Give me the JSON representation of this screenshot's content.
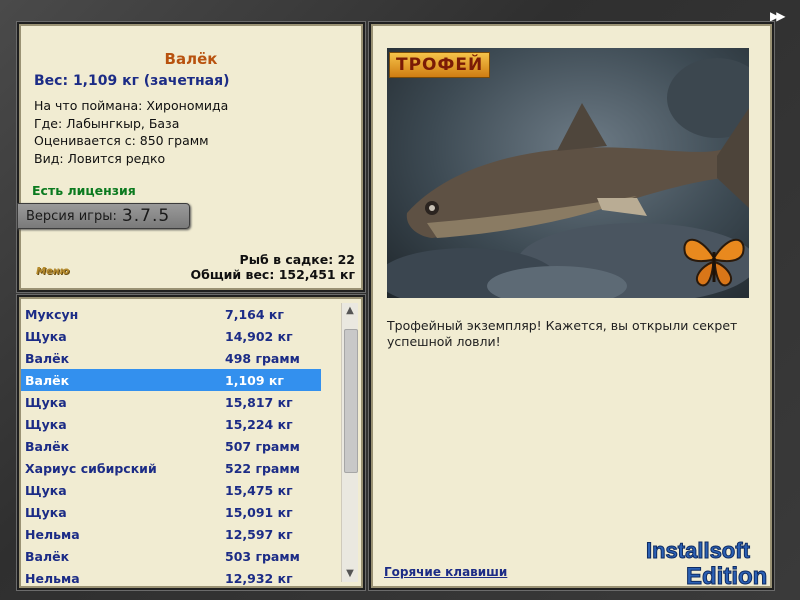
{
  "fish": {
    "name": "Валёк",
    "weight_line": "Вес: 1,109 кг (зачетная)",
    "caught_on": "На что поймана: Хирономида",
    "location": "Где: Лабынгкыр, База",
    "valued_from": "Оценивается с: 850 грамм",
    "species_rarity": "Вид: Ловится редко"
  },
  "license_text": "Есть лицензия",
  "version": {
    "label": "Версия игры:",
    "number": "3.7.5"
  },
  "menu_label": "Меню",
  "stats": {
    "fish_count": "Рыб в садке: 22",
    "total_weight": "Общий вес: 152,451 кг"
  },
  "catch_list": [
    {
      "name": "Муксун",
      "weight": "7,164 кг"
    },
    {
      "name": "Щука",
      "weight": "14,902 кг"
    },
    {
      "name": "Валёк",
      "weight": "498 грамм"
    },
    {
      "name": "Валёк",
      "weight": "1,109 кг",
      "selected": true
    },
    {
      "name": "Щука",
      "weight": "15,817 кг"
    },
    {
      "name": "Щука",
      "weight": "15,224 кг"
    },
    {
      "name": "Валёк",
      "weight": "507 грамм"
    },
    {
      "name": "Хариус сибирский",
      "weight": "522 грамм"
    },
    {
      "name": "Щука",
      "weight": "15,475 кг"
    },
    {
      "name": "Щука",
      "weight": "15,091 кг"
    },
    {
      "name": "Нельма",
      "weight": "12,597 кг"
    },
    {
      "name": "Валёк",
      "weight": "503 грамм"
    },
    {
      "name": "Нельма",
      "weight": "12,932 кг"
    }
  ],
  "trophy_badge": "ТРОФЕЙ",
  "description": "Трофейный экземпляр! Кажется, вы открыли секрет успешной ловли!",
  "hotkeys_link": "Горячие клавиши",
  "watermark": {
    "line1": "Installsoft",
    "line2": "Edition"
  },
  "icons": {
    "next": "double-arrow-right-icon",
    "butterfly": "butterfly-icon"
  },
  "colors": {
    "panel_bg": "#f1ecd2",
    "fish_name": "#b8520f",
    "blue_text": "#1c2c86",
    "license": "#0b7a1f",
    "selection": "#3390ee"
  }
}
